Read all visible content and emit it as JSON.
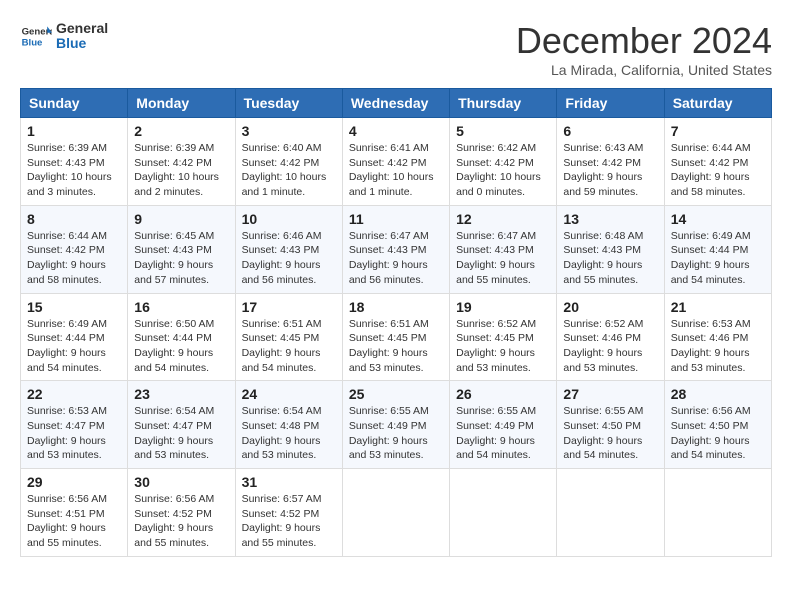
{
  "logo": {
    "text_general": "General",
    "text_blue": "Blue",
    "icon_label": "general-blue-logo"
  },
  "header": {
    "month": "December 2024",
    "location": "La Mirada, California, United States"
  },
  "weekdays": [
    "Sunday",
    "Monday",
    "Tuesday",
    "Wednesday",
    "Thursday",
    "Friday",
    "Saturday"
  ],
  "weeks": [
    [
      {
        "day": "1",
        "sunrise": "6:39 AM",
        "sunset": "4:43 PM",
        "daylight": "10 hours and 3 minutes."
      },
      {
        "day": "2",
        "sunrise": "6:39 AM",
        "sunset": "4:42 PM",
        "daylight": "10 hours and 2 minutes."
      },
      {
        "day": "3",
        "sunrise": "6:40 AM",
        "sunset": "4:42 PM",
        "daylight": "10 hours and 1 minute."
      },
      {
        "day": "4",
        "sunrise": "6:41 AM",
        "sunset": "4:42 PM",
        "daylight": "10 hours and 1 minute."
      },
      {
        "day": "5",
        "sunrise": "6:42 AM",
        "sunset": "4:42 PM",
        "daylight": "10 hours and 0 minutes."
      },
      {
        "day": "6",
        "sunrise": "6:43 AM",
        "sunset": "4:42 PM",
        "daylight": "9 hours and 59 minutes."
      },
      {
        "day": "7",
        "sunrise": "6:44 AM",
        "sunset": "4:42 PM",
        "daylight": "9 hours and 58 minutes."
      }
    ],
    [
      {
        "day": "8",
        "sunrise": "6:44 AM",
        "sunset": "4:42 PM",
        "daylight": "9 hours and 58 minutes."
      },
      {
        "day": "9",
        "sunrise": "6:45 AM",
        "sunset": "4:43 PM",
        "daylight": "9 hours and 57 minutes."
      },
      {
        "day": "10",
        "sunrise": "6:46 AM",
        "sunset": "4:43 PM",
        "daylight": "9 hours and 56 minutes."
      },
      {
        "day": "11",
        "sunrise": "6:47 AM",
        "sunset": "4:43 PM",
        "daylight": "9 hours and 56 minutes."
      },
      {
        "day": "12",
        "sunrise": "6:47 AM",
        "sunset": "4:43 PM",
        "daylight": "9 hours and 55 minutes."
      },
      {
        "day": "13",
        "sunrise": "6:48 AM",
        "sunset": "4:43 PM",
        "daylight": "9 hours and 55 minutes."
      },
      {
        "day": "14",
        "sunrise": "6:49 AM",
        "sunset": "4:44 PM",
        "daylight": "9 hours and 54 minutes."
      }
    ],
    [
      {
        "day": "15",
        "sunrise": "6:49 AM",
        "sunset": "4:44 PM",
        "daylight": "9 hours and 54 minutes."
      },
      {
        "day": "16",
        "sunrise": "6:50 AM",
        "sunset": "4:44 PM",
        "daylight": "9 hours and 54 minutes."
      },
      {
        "day": "17",
        "sunrise": "6:51 AM",
        "sunset": "4:45 PM",
        "daylight": "9 hours and 54 minutes."
      },
      {
        "day": "18",
        "sunrise": "6:51 AM",
        "sunset": "4:45 PM",
        "daylight": "9 hours and 53 minutes."
      },
      {
        "day": "19",
        "sunrise": "6:52 AM",
        "sunset": "4:45 PM",
        "daylight": "9 hours and 53 minutes."
      },
      {
        "day": "20",
        "sunrise": "6:52 AM",
        "sunset": "4:46 PM",
        "daylight": "9 hours and 53 minutes."
      },
      {
        "day": "21",
        "sunrise": "6:53 AM",
        "sunset": "4:46 PM",
        "daylight": "9 hours and 53 minutes."
      }
    ],
    [
      {
        "day": "22",
        "sunrise": "6:53 AM",
        "sunset": "4:47 PM",
        "daylight": "9 hours and 53 minutes."
      },
      {
        "day": "23",
        "sunrise": "6:54 AM",
        "sunset": "4:47 PM",
        "daylight": "9 hours and 53 minutes."
      },
      {
        "day": "24",
        "sunrise": "6:54 AM",
        "sunset": "4:48 PM",
        "daylight": "9 hours and 53 minutes."
      },
      {
        "day": "25",
        "sunrise": "6:55 AM",
        "sunset": "4:49 PM",
        "daylight": "9 hours and 53 minutes."
      },
      {
        "day": "26",
        "sunrise": "6:55 AM",
        "sunset": "4:49 PM",
        "daylight": "9 hours and 54 minutes."
      },
      {
        "day": "27",
        "sunrise": "6:55 AM",
        "sunset": "4:50 PM",
        "daylight": "9 hours and 54 minutes."
      },
      {
        "day": "28",
        "sunrise": "6:56 AM",
        "sunset": "4:50 PM",
        "daylight": "9 hours and 54 minutes."
      }
    ],
    [
      {
        "day": "29",
        "sunrise": "6:56 AM",
        "sunset": "4:51 PM",
        "daylight": "9 hours and 55 minutes."
      },
      {
        "day": "30",
        "sunrise": "6:56 AM",
        "sunset": "4:52 PM",
        "daylight": "9 hours and 55 minutes."
      },
      {
        "day": "31",
        "sunrise": "6:57 AM",
        "sunset": "4:52 PM",
        "daylight": "9 hours and 55 minutes."
      },
      null,
      null,
      null,
      null
    ]
  ],
  "labels": {
    "sunrise": "Sunrise:",
    "sunset": "Sunset:",
    "daylight": "Daylight:"
  }
}
